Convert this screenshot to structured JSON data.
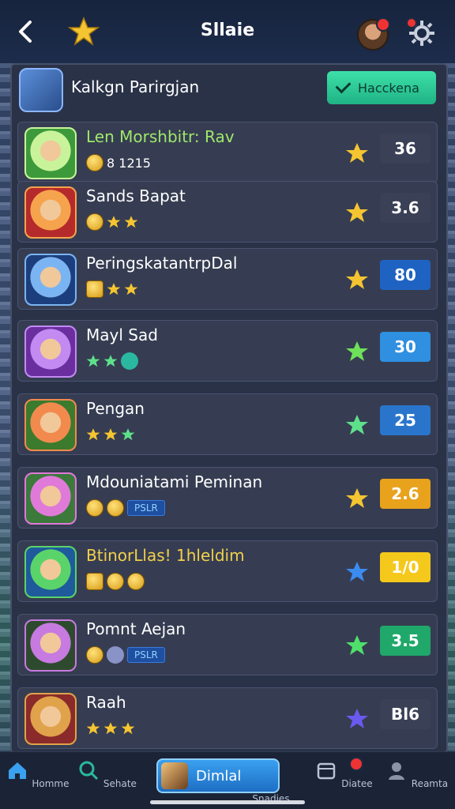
{
  "header": {
    "title": "Sllaie",
    "filter_label": "Hacckena"
  },
  "subheader": {
    "label": "Kalkgn Parirgjan"
  },
  "colors": {
    "accent_green": "#1fb385",
    "panel": "#2a3247"
  },
  "rows": [
    {
      "name": "Len Morshbitr: Rav",
      "name_color": "#9fe86a",
      "sub_text": "8 1215",
      "sub_icons": [
        "coin"
      ],
      "star_color": "#f5c531",
      "score": "36",
      "score_bg": "#3a4156",
      "avatar_colors": [
        "#c9f39b",
        "#3c9a3a"
      ]
    },
    {
      "name": "Sands Bapat",
      "name_color": "#ffffff",
      "sub_text": "",
      "sub_icons": [
        "coin",
        "star",
        "star"
      ],
      "star_color": "#f5c531",
      "score": "3.6",
      "score_bg": "#3a4156",
      "avatar_colors": [
        "#f6a34e",
        "#b52a2a"
      ]
    },
    {
      "name": "PeringskatantrpDal",
      "name_color": "#ffffff",
      "sub_text": "",
      "sub_icons": [
        "crown",
        "star",
        "star"
      ],
      "star_color": "#f5c531",
      "score": "80",
      "score_bg": "#1f63c2",
      "avatar_colors": [
        "#7bb4f2",
        "#1d3e7c"
      ]
    },
    {
      "name": "Mayl Sad",
      "name_color": "#ffffff",
      "sub_text": "",
      "sub_icons": [
        "star-green",
        "star-green",
        "dot"
      ],
      "star_color": "#6fe05a",
      "score": "30",
      "score_bg": "#2f8fe0",
      "avatar_colors": [
        "#c38af2",
        "#6a2e9e"
      ]
    },
    {
      "name": "Pengan",
      "name_color": "#ffffff",
      "sub_text": "",
      "sub_icons": [
        "star",
        "star",
        "star-green"
      ],
      "star_color": "#5ee08a",
      "score": "25",
      "score_bg": "#2a75cc",
      "avatar_colors": [
        "#f28a4e",
        "#3c7a2e"
      ]
    },
    {
      "name": "Mdouniatami Peminan",
      "name_color": "#ffffff",
      "sub_text": "",
      "sub_icons": [
        "coin",
        "coin"
      ],
      "tag": "PSLR",
      "star_color": "#f5c531",
      "score": "2.6",
      "score_bg": "#e8a21c",
      "avatar_colors": [
        "#e07ad9",
        "#3b7a3a"
      ]
    },
    {
      "name": "BtinorLlas! 1hleldim",
      "name_color": "#f2d04a",
      "sub_text": "",
      "sub_icons": [
        "crown",
        "coin",
        "coin"
      ],
      "star_color": "#3a8cf0",
      "score": "1/0",
      "score_bg": "#f5c81c",
      "avatar_colors": [
        "#5ad46a",
        "#1e5a9c"
      ]
    },
    {
      "name": "Pomnt Aejan",
      "name_color": "#ffffff",
      "sub_text": "",
      "sub_icons": [
        "coin",
        "dot-gray"
      ],
      "tag": "PSLR",
      "star_color": "#4fe06a",
      "score": "3.5",
      "score_bg": "#1fa86a",
      "avatar_colors": [
        "#c77adf",
        "#2e4a2e"
      ]
    },
    {
      "name": "Raah",
      "name_color": "#ffffff",
      "sub_text": "",
      "sub_icons": [
        "star",
        "star",
        "star"
      ],
      "star_color": "#6a5af0",
      "score": "Bl6",
      "score_bg": "#3a4156",
      "avatar_colors": [
        "#e0a24a",
        "#8a2a2a"
      ]
    }
  ],
  "nav": {
    "home": "Homme",
    "search": "Sehate",
    "center": "Dimlal",
    "rewards": "Snadies",
    "events": "Diatee",
    "profile": "Reamta"
  }
}
